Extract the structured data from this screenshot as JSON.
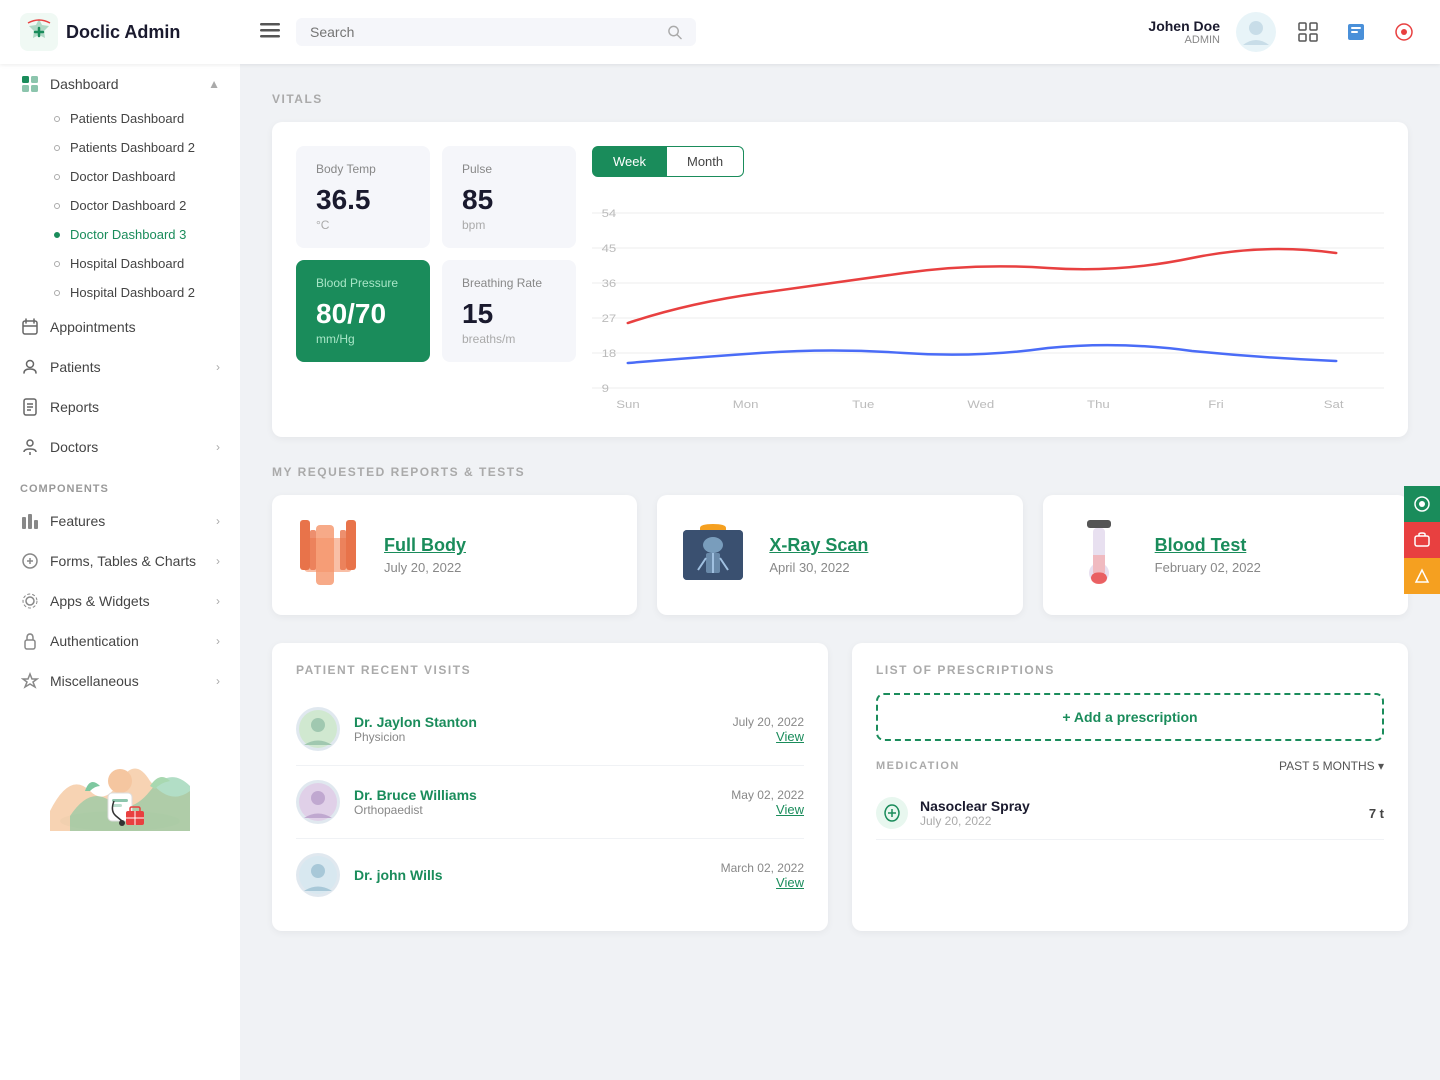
{
  "header": {
    "logo_text": "Doclic Admin",
    "search_placeholder": "Search",
    "user_name": "Johen Doe",
    "user_role": "ADMIN"
  },
  "sidebar": {
    "dashboard_label": "Dashboard",
    "nav_items": [
      {
        "label": "Patients Dashboard",
        "active": false
      },
      {
        "label": "Patients Dashboard 2",
        "active": false
      },
      {
        "label": "Doctor Dashboard",
        "active": false
      },
      {
        "label": "Doctor Dashboard 2",
        "active": false
      },
      {
        "label": "Doctor Dashboard 3",
        "active": true
      },
      {
        "label": "Hospital Dashboard",
        "active": false
      },
      {
        "label": "Hospital Dashboard 2",
        "active": false
      }
    ],
    "main_items": [
      {
        "label": "Appointments",
        "has_arrow": false
      },
      {
        "label": "Patients",
        "has_arrow": true
      },
      {
        "label": "Reports",
        "has_arrow": false
      },
      {
        "label": "Doctors",
        "has_arrow": true
      }
    ],
    "components_label": "COMPONENTS",
    "component_items": [
      {
        "label": "Features",
        "has_arrow": true
      },
      {
        "label": "Forms, Tables & Charts",
        "has_arrow": true
      },
      {
        "label": "Apps & Widgets",
        "has_arrow": true
      },
      {
        "label": "Authentication",
        "has_arrow": true
      },
      {
        "label": "Miscellaneous",
        "has_arrow": true
      }
    ]
  },
  "vitals": {
    "section_title": "VITALS",
    "body_temp_label": "Body Temp",
    "body_temp_value": "36.5",
    "body_temp_unit": "°C",
    "pulse_label": "Pulse",
    "pulse_value": "85",
    "pulse_unit": "bpm",
    "bp_label": "Blood Pressure",
    "bp_value": "80/70",
    "bp_unit": "mm/Hg",
    "br_label": "Breathing Rate",
    "br_value": "15",
    "br_unit": "breaths/m",
    "week_btn": "Week",
    "month_btn": "Month",
    "chart_days": [
      "Sun",
      "Mon",
      "Tue",
      "Wed",
      "Thu",
      "Fri",
      "Sat"
    ],
    "chart_y": [
      9,
      18,
      27,
      36,
      45,
      54
    ]
  },
  "reports": {
    "section_title": "MY REQUESTED REPORTS & TESTS",
    "items": [
      {
        "name": "Full Body",
        "date": "July 20, 2022"
      },
      {
        "name": "X-Ray Scan",
        "date": "April 30, 2022"
      },
      {
        "name": "Blood Test",
        "date": "February 02, 2022"
      }
    ]
  },
  "visits": {
    "section_title": "PATIENT RECENT VISITS",
    "items": [
      {
        "name": "Dr. Jaylon Stanton",
        "specialty": "Physicion",
        "date": "July 20, 2022",
        "view": "View"
      },
      {
        "name": "Dr. Bruce Williams",
        "specialty": "Orthopaedist",
        "date": "May 02, 2022",
        "view": "View"
      },
      {
        "name": "Dr. john Wills",
        "specialty": "",
        "date": "March 02, 2022",
        "view": "View"
      }
    ]
  },
  "prescriptions": {
    "section_title": "LIST OF PRESCRIPTIONS",
    "add_label": "+ Add a prescription",
    "med_label": "MEDICATION",
    "period_label": "PAST 5 MONTHS",
    "items": [
      {
        "name": "Nasoclear Spray",
        "date": "July 20, 2022",
        "count": "7 t"
      }
    ]
  }
}
